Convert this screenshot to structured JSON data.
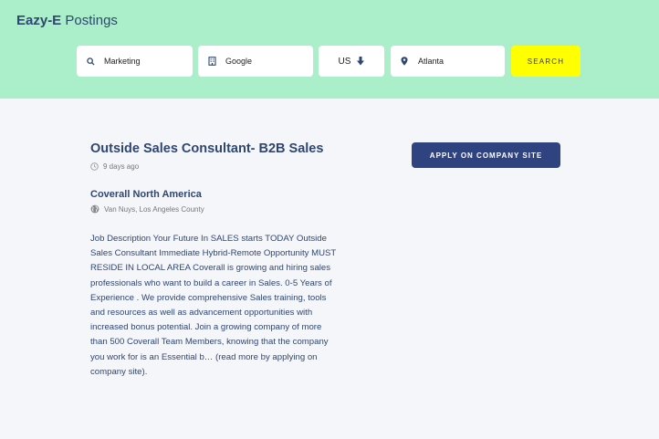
{
  "header": {
    "brand_bold": "Eazy-E",
    "brand_rest": "Postings"
  },
  "search": {
    "keyword": {
      "value": "Marketing",
      "icon": "search-icon"
    },
    "company": {
      "value": "Google",
      "icon": "building-icon"
    },
    "country": {
      "value": "US",
      "icon": "arrow-down-icon"
    },
    "location": {
      "value": "Atlanta",
      "icon": "map-pin-icon"
    },
    "button_label": "SEARCH"
  },
  "job": {
    "title": "Outside Sales Consultant- B2B Sales",
    "posted": "9 days ago",
    "apply_label": "APPLY ON COMPANY SITE",
    "company": "Coverall North America",
    "location": "Van Nuys, Los Angeles County",
    "description": "Job Description Your Future In SALES starts TODAY Outside Sales Consultant Immediate Hybrid-Remote Opportunity MUST RESIDE IN LOCAL AREA Coverall is growing and hiring sales professionals who want to build a career in Sales. 0-5 Years of Experience . We provide comprehensive Sales training, tools and resources as well as advancement opportunities with increased bonus potential. Join a growing company of more than 500 Coverall Team Members, knowing that the company you work for is an Essential b… (read more by applying on company site)."
  },
  "colors": {
    "header_bg": "#abeeca",
    "page_bg": "#f5f6fa",
    "primary": "#2f4380",
    "search_button": "#ffff00",
    "text_primary": "#2f4673"
  }
}
